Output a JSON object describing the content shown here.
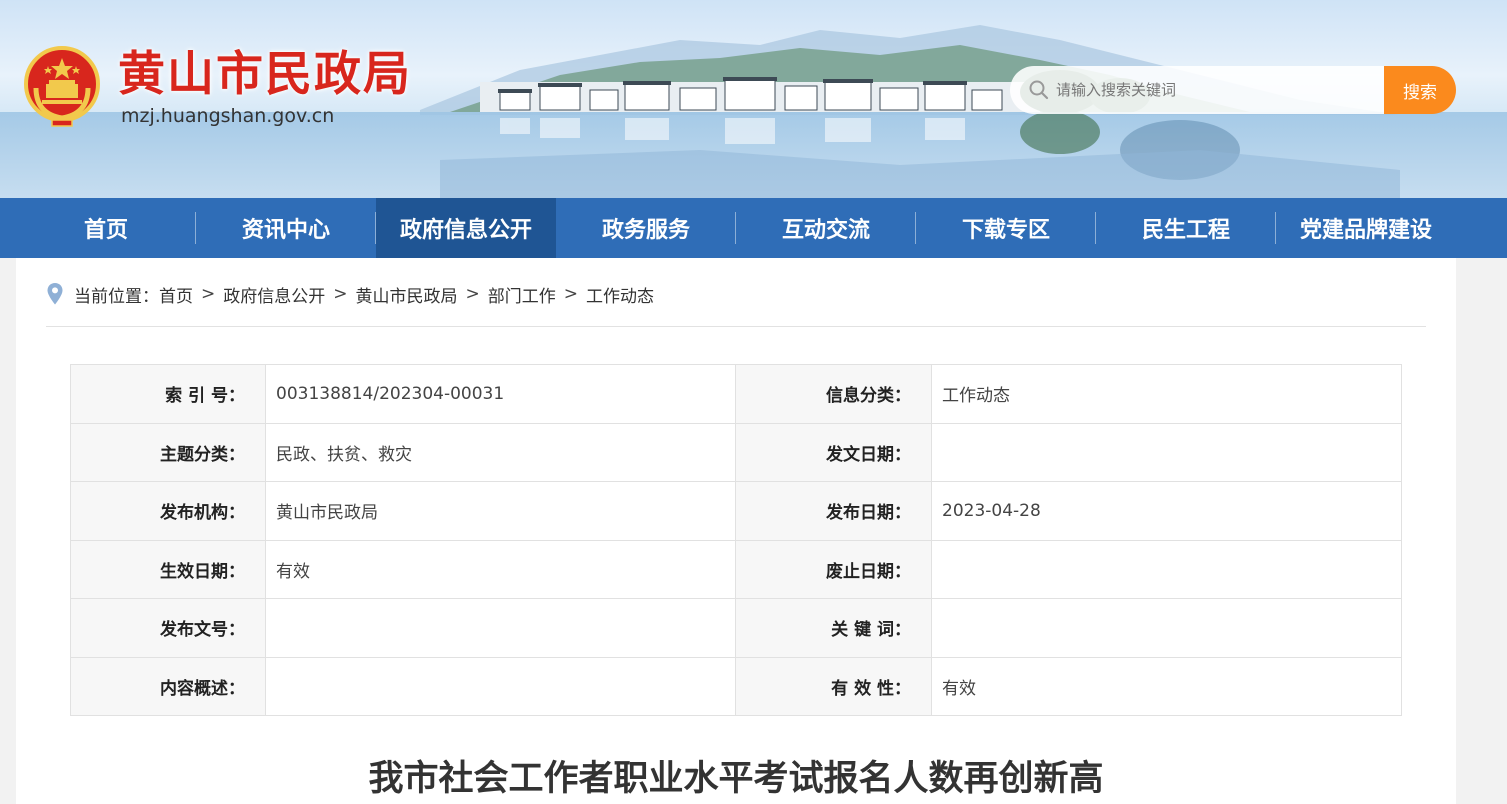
{
  "header": {
    "site_title": "黄山市民政局",
    "site_domain": "mzj.huangshan.gov.cn",
    "search_placeholder": "请输入搜索关键词",
    "search_button": "搜索",
    "icons": {
      "emblem": "national-emblem-icon",
      "search": "search-icon"
    },
    "colors": {
      "title": "#d8261d",
      "search_button": "#fb8a1d"
    }
  },
  "nav": {
    "items": [
      {
        "label": "首页"
      },
      {
        "label": "资讯中心"
      },
      {
        "label": "政府信息公开"
      },
      {
        "label": "政务服务"
      },
      {
        "label": "互动交流"
      },
      {
        "label": "下载专区"
      },
      {
        "label": "民生工程"
      },
      {
        "label": "党建品牌建设"
      }
    ],
    "active_index": 2,
    "colors": {
      "bar": "#2f6db7",
      "active": "#1f5594"
    }
  },
  "breadcrumb": {
    "prefix": "当前位置：",
    "items": [
      "首页",
      "政府信息公开",
      "黄山市民政局",
      "部门工作",
      "工作动态"
    ],
    "separator": ">",
    "icon": "location-pin-icon"
  },
  "meta_table": {
    "rows": [
      {
        "k1": "索 引 号：",
        "v1": "003138814/202304-00031",
        "k2": "信息分类：",
        "v2": "工作动态"
      },
      {
        "k1": "主题分类：",
        "v1": "民政、扶贫、救灾",
        "k2": "发文日期：",
        "v2": ""
      },
      {
        "k1": "发布机构：",
        "v1": "黄山市民政局",
        "k2": "发布日期：",
        "v2": "2023-04-28"
      },
      {
        "k1": "生效日期：",
        "v1": "有效",
        "k2": "废止日期：",
        "v2": ""
      },
      {
        "k1": "发布文号：",
        "v1": "",
        "k2": "关 键 词：",
        "v2": ""
      },
      {
        "k1": "内容概述：",
        "v1": "",
        "k2": "有 效 性：",
        "v2": "有效"
      }
    ]
  },
  "article": {
    "title": "我市社会工作者职业水平考试报名人数再创新高"
  }
}
